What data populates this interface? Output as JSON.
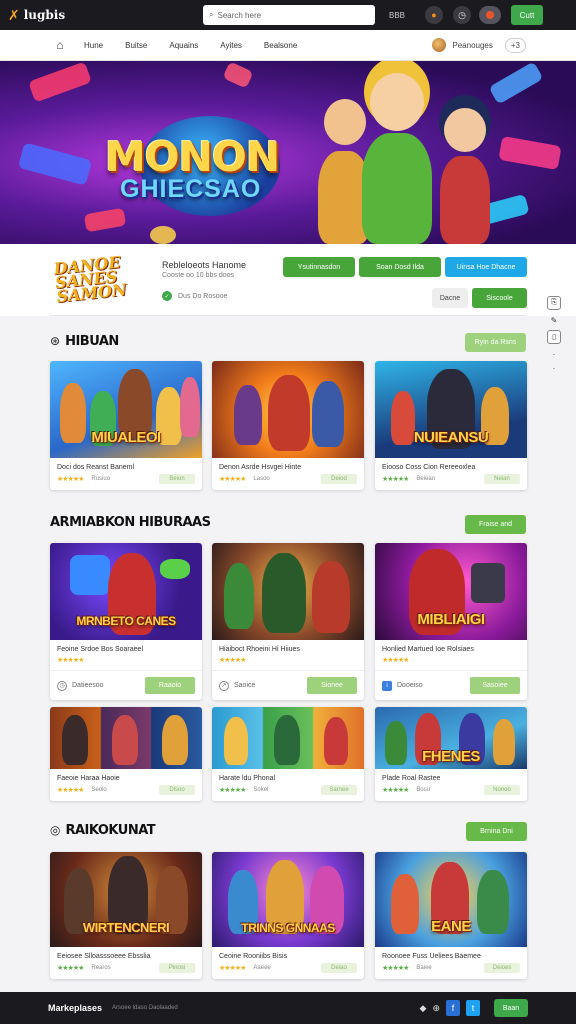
{
  "topbar": {
    "logo_text": "lugbis",
    "search_placeholder": "Search here",
    "mini_label": "BBB",
    "cta_label": "Cutt"
  },
  "nav": {
    "items": [
      "Hune",
      "Buitse",
      "Aquains",
      "Ayites",
      "Bealsone"
    ],
    "account_name": "Peanouges",
    "account_count": "+3"
  },
  "hero": {
    "title": "MONON",
    "subtitle": "GHIECSAO"
  },
  "info": {
    "logo_text": "DANOE SANES SAMON",
    "game_name": "Rebleloeots Hanome",
    "game_sub": "Cooste oo 10 bbs doos",
    "vote_text": "Dus Do Rosooe",
    "btn1": "Ysutinnasdon",
    "btn2": "Soan Dosd Ilda",
    "btn3": "Uinsa Hoe Dhacne",
    "btn4": "Dacne",
    "btn5": "Siscoole"
  },
  "sections": [
    {
      "title": "HIBUAN",
      "view_all": "Ryin da Rsns",
      "cards": [
        {
          "thumb_title": "MIUALEOI",
          "name": "Doci dos Reanst Baneml",
          "rating_text": "Rusiuo",
          "pill": "Beion"
        },
        {
          "thumb_title": "",
          "name": "Denon Asrde Hsvgei Hinte",
          "rating_text": "Lasoo",
          "pill": "Deiod"
        },
        {
          "thumb_title": "NUIEANSU",
          "name": "Eiooso Coss Cion Rereeoxlea",
          "rating_text": "Beiean",
          "pill": "Neian"
        }
      ]
    },
    {
      "title": "ARMIABKON HIBURAAS",
      "view_all": "Fraise and",
      "cards": [
        {
          "thumb_title": "MRNBETO CANES",
          "name": "Feoine Srdoe Bos Soaraeel",
          "rating_text": "",
          "action_label": "Datieesoo",
          "action_btn": "Raaoio"
        },
        {
          "thumb_title": "",
          "name": "Hiaiboct Rhoeini Hi Hiiues",
          "rating_text": "",
          "action_label": "Saoice",
          "action_btn": "Sionee"
        },
        {
          "thumb_title": "MIBLIAIGI",
          "name": "Honlied Martued Ioe Rolsiaes",
          "rating_text": "",
          "action_label": "Dooeiso",
          "action_btn": "Sasoiee"
        },
        {
          "thumb_title": "",
          "name": "Faeoie Haraa Haoie",
          "rating_text": "Seolo",
          "pill": "Dlsoo"
        },
        {
          "thumb_title": "",
          "name": "Harate ldu Phonal",
          "rating_text": "Sokel",
          "pill": "Sarnee"
        },
        {
          "thumb_title": "FHENES",
          "name": "Plade Roal Rastee",
          "rating_text": "Bosu",
          "pill": "Nonoo"
        }
      ]
    },
    {
      "title": "RAIKOKUNAT",
      "view_all": "Brnina Dni",
      "cards": [
        {
          "thumb_title": "WIRTENCNERI",
          "name": "Eeiosee Slloasssoeee Ebsslia",
          "rating_text": "Rearos",
          "pill": "Pinosi"
        },
        {
          "thumb_title": "TRINNS GNNAAS",
          "name": "Ceoine Rooniibs Bisis",
          "rating_text": "Aaeee",
          "pill": "Deiao"
        },
        {
          "thumb_title": "EANE",
          "name": "Roonoee Fuss Ueliees Baemee",
          "rating_text": "Baiee",
          "pill": "Deioes"
        }
      ]
    }
  ],
  "footer": {
    "brand": "Markeplases",
    "copy": "Arsoee ldaso Daolaaded",
    "cta": "Baan"
  },
  "colors": {
    "accent_green": "#47a53a",
    "accent_blue": "#1fa8e8",
    "dark_bar": "#1b1b1f",
    "star": "#f2b21a"
  }
}
